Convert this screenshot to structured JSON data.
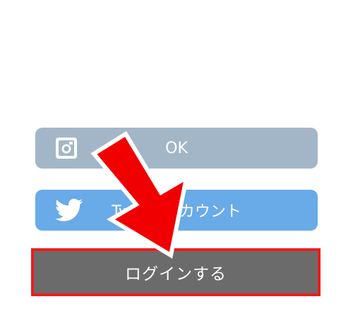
{
  "buttons": {
    "instagram": {
      "label": "OK",
      "icon": "instagram-icon",
      "color": "#a3b6c8"
    },
    "twitter": {
      "label": "Twitterアカウント",
      "icon": "twitter-bird-icon",
      "color": "#69aae8"
    },
    "login": {
      "label": "ログインする",
      "color": "#6b6b6b",
      "highlight_color": "#ee1c1c"
    }
  },
  "annotation": {
    "icon": "red-arrow-icon",
    "color": "#f00000"
  }
}
